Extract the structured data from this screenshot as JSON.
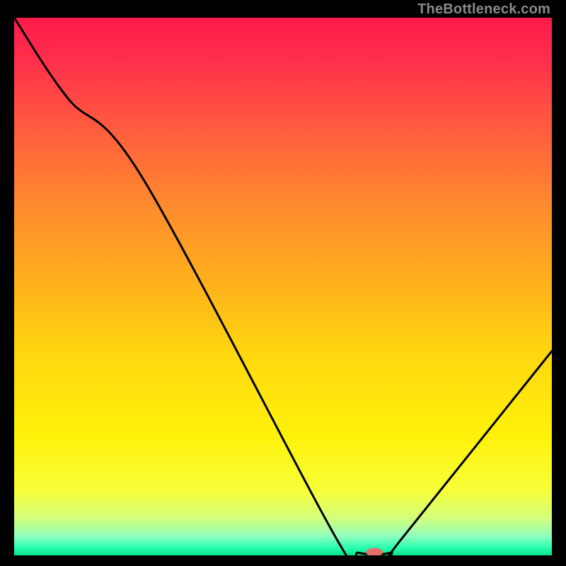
{
  "watermark": "TheBottleneck.com",
  "chart_data": {
    "type": "line",
    "title": "",
    "xlabel": "",
    "ylabel": "",
    "xlim": [
      0,
      100
    ],
    "ylim": [
      0,
      100
    ],
    "grid": false,
    "legend": false,
    "series": [
      {
        "name": "bottleneck-curve",
        "x": [
          0,
          10,
          24,
          60,
          64,
          70,
          72,
          100
        ],
        "y": [
          100,
          85,
          70,
          3,
          0.5,
          0.5,
          3,
          38
        ]
      }
    ],
    "gradient_stops": [
      {
        "offset": 0.0,
        "color": "#ff1a4b"
      },
      {
        "offset": 0.08,
        "color": "#ff2f4b"
      },
      {
        "offset": 0.2,
        "color": "#ff5a3f"
      },
      {
        "offset": 0.35,
        "color": "#ff8b2e"
      },
      {
        "offset": 0.5,
        "color": "#ffb31a"
      },
      {
        "offset": 0.63,
        "color": "#ffd80f"
      },
      {
        "offset": 0.78,
        "color": "#fff20a"
      },
      {
        "offset": 0.88,
        "color": "#f6ff3a"
      },
      {
        "offset": 0.93,
        "color": "#d4ff7a"
      },
      {
        "offset": 0.965,
        "color": "#8effc0"
      },
      {
        "offset": 0.985,
        "color": "#2affb0"
      },
      {
        "offset": 1.0,
        "color": "#09e38a"
      }
    ],
    "marker": {
      "x": 67,
      "y": 0.6,
      "color": "#e2716e",
      "rx": 12,
      "ry": 6
    }
  }
}
